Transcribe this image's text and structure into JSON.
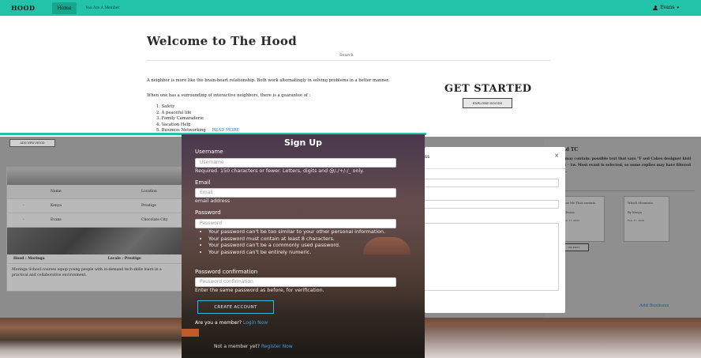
{
  "navbar": {
    "brand": "HOOD",
    "home": "Home",
    "member_link": "You Are A Member",
    "user": "Evans"
  },
  "welcome": {
    "title": "Welcome to The Hood",
    "search_label": "Search",
    "intro": "A neighbor is more like the brain-heart relationship. Both work alternatingly in solving problems in a better manner.",
    "intro2": "When one has a surrounding of interactive neighbors, there is a guarantee of :",
    "benefits": [
      "1. Safety",
      "2. A peaceful life",
      "3. Family Camaraderie",
      "4. Vacation Help",
      "5. Business Networking"
    ],
    "read_more": "READ MORE"
  },
  "get_started": {
    "title": "GET STARTED",
    "explore_button": "EXPLORE HOODS"
  },
  "add_hood_button": "ADD NEW HOOD",
  "hood_card": {
    "headers": [
      "",
      "Name",
      "Location"
    ],
    "rows": [
      {
        "marker": "-",
        "name": "Kenya",
        "location": "Prestige"
      },
      {
        "marker": "-",
        "name": "Evans",
        "location": "Chocolate City"
      }
    ],
    "hood_label": "Hood : Moringa",
    "locale_label": "Locale : Prestige",
    "description": "Moringa School courses equip young people with in-demand tech skills learn in a practical and collaborative environment."
  },
  "right_panel": {
    "title": "und TC",
    "text": "ge may contain: possible text that says \"F sed Cakes designer kisii ... 1 · 1w. Most evant is selected, so some replies may have filtered out.",
    "card1_title": "ilow Me That ountain",
    "card1_by": "y Evans",
    "card1_date": "Feb. 17, 2020",
    "card2_title": "Which Mountain",
    "card2_by": "By Kenya",
    "card2_date": "Feb. 17, 2020",
    "button": "ON POST",
    "add_business": "Add Business"
  },
  "business_modal": {
    "title": "ss",
    "close": "×"
  },
  "signup": {
    "title": "Sign Up",
    "username_label": "Username",
    "username_placeholder": "Username",
    "username_help": "Required. 150 characters or fewer. Letters, digits and @/./+/-/_ only.",
    "email_label": "Email",
    "email_placeholder": "Email",
    "email_help": "email address",
    "password_label": "Password",
    "password_placeholder": "Password",
    "password_rules": [
      "Your password can't be too similar to your other personal information.",
      "Your password must contain at least 8 characters.",
      "Your password can't be a commonly used password.",
      "Your password can't be entirely numeric."
    ],
    "confirm_label": "Password confirmation",
    "confirm_placeholder": "Password confirmation",
    "confirm_help": "Enter the same password as before, for verification.",
    "create_button": "CREATE ACCOUNT",
    "member_text": "Are you a member?",
    "login_link": "Login Now",
    "not_member_text": "Not a member yet?",
    "register_link": "Register Now"
  }
}
